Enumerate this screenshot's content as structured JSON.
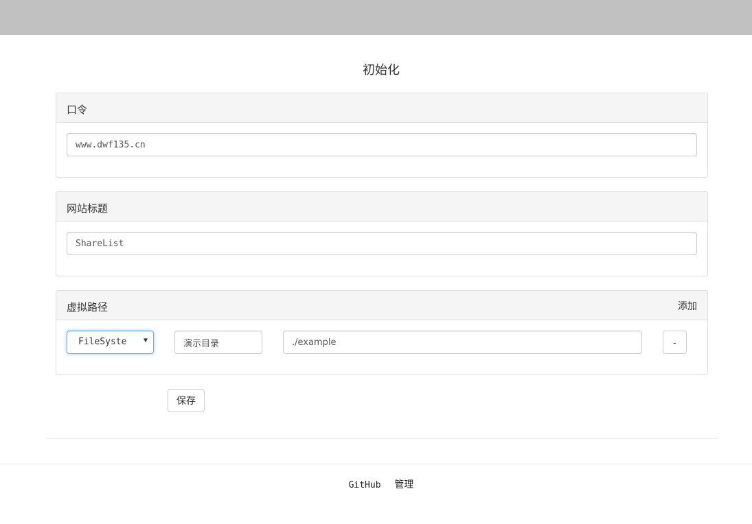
{
  "page": {
    "title": "初始化"
  },
  "token": {
    "label": "口令",
    "value": "www.dwf135.cn"
  },
  "site_title": {
    "label": "网站标题",
    "value": "ShareList"
  },
  "virtual_paths": {
    "label": "虚拟路径",
    "add_label": "添加",
    "rows": [
      {
        "type": "FileSystem",
        "type_display": "FileSyste",
        "name": "演示目录",
        "path": "./example",
        "remove_label": "-"
      }
    ]
  },
  "save_label": "保存",
  "footer": {
    "links": [
      "GitHub",
      "管理"
    ]
  }
}
